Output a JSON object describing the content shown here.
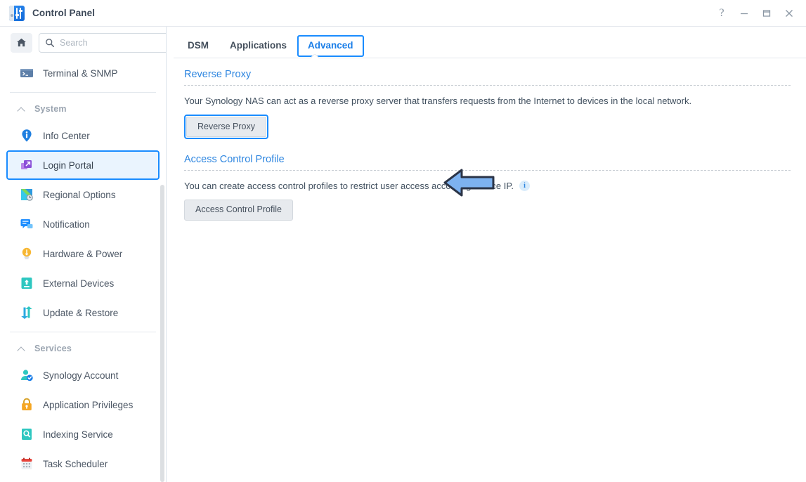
{
  "window": {
    "title": "Control Panel",
    "app_icon": "control-panel-icon",
    "controls": {
      "help": "?",
      "minimize": "minimize-icon",
      "maximize": "maximize-icon",
      "close": "close-icon"
    }
  },
  "sidebar": {
    "home_button": "home-icon",
    "search": {
      "placeholder": "Search",
      "value": "",
      "icon": "search-icon"
    },
    "entries": [
      {
        "kind": "item",
        "label": "Terminal & SNMP",
        "icon": "terminal-icon",
        "selected": false
      },
      {
        "kind": "divider"
      },
      {
        "kind": "group",
        "label": "System",
        "icon": "chevron-up-icon"
      },
      {
        "kind": "item",
        "label": "Info Center",
        "icon": "info-center-icon",
        "selected": false
      },
      {
        "kind": "item",
        "label": "Login Portal",
        "icon": "login-portal-icon",
        "selected": true
      },
      {
        "kind": "item",
        "label": "Regional Options",
        "icon": "regional-options-icon",
        "selected": false
      },
      {
        "kind": "item",
        "label": "Notification",
        "icon": "notification-icon",
        "selected": false
      },
      {
        "kind": "item",
        "label": "Hardware & Power",
        "icon": "hardware-power-icon",
        "selected": false
      },
      {
        "kind": "item",
        "label": "External Devices",
        "icon": "external-devices-icon",
        "selected": false
      },
      {
        "kind": "item",
        "label": "Update & Restore",
        "icon": "update-restore-icon",
        "selected": false
      },
      {
        "kind": "divider"
      },
      {
        "kind": "group",
        "label": "Services",
        "icon": "chevron-up-icon"
      },
      {
        "kind": "item",
        "label": "Synology Account",
        "icon": "synology-account-icon",
        "selected": false
      },
      {
        "kind": "item",
        "label": "Application Privileges",
        "icon": "application-privileges-icon",
        "selected": false
      },
      {
        "kind": "item",
        "label": "Indexing Service",
        "icon": "indexing-service-icon",
        "selected": false
      },
      {
        "kind": "item",
        "label": "Task Scheduler",
        "icon": "task-scheduler-icon",
        "selected": false
      }
    ],
    "scrollbar": true
  },
  "main": {
    "tabs": [
      {
        "label": "DSM",
        "active": false
      },
      {
        "label": "Applications",
        "active": false
      },
      {
        "label": "Advanced",
        "active": true
      }
    ],
    "sections": [
      {
        "title": "Reverse Proxy",
        "description": "Your Synology NAS can act as a reverse proxy server that transfers requests from the Internet to devices in the local network.",
        "has_info_icon": false,
        "button_label": "Reverse Proxy",
        "button_focused": true
      },
      {
        "title": "Access Control Profile",
        "description": "You can create access control profiles to restrict user access according source IP.",
        "has_info_icon": true,
        "button_label": "Access Control Profile",
        "button_focused": false
      }
    ]
  },
  "annotation": {
    "arrow": {
      "direction": "left",
      "fill": "#7db2f0",
      "stroke": "#2b3447",
      "points_at": "Reverse Proxy"
    }
  },
  "colors": {
    "accent": "#1a8cff",
    "link": "#2e86e0",
    "selected_bg": "#eaf4fe",
    "text": "#41505f",
    "muted": "#9aa4b0"
  }
}
